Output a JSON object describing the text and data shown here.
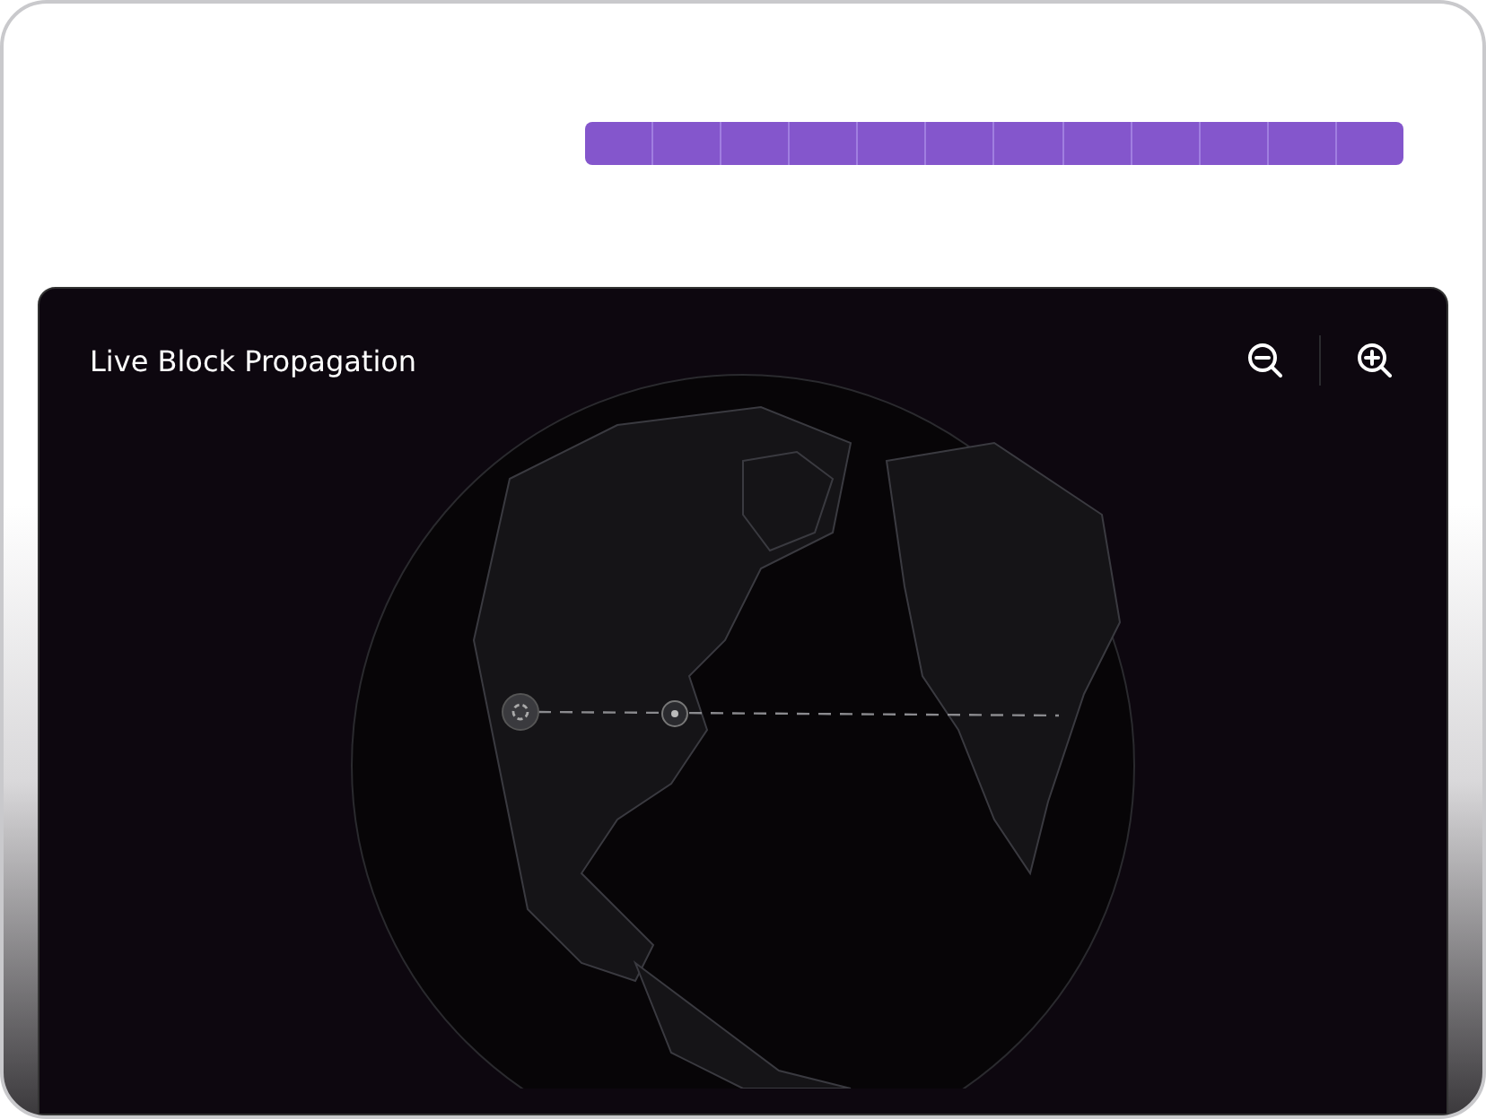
{
  "panel": {
    "title": "Live Block Propagation"
  }
}
